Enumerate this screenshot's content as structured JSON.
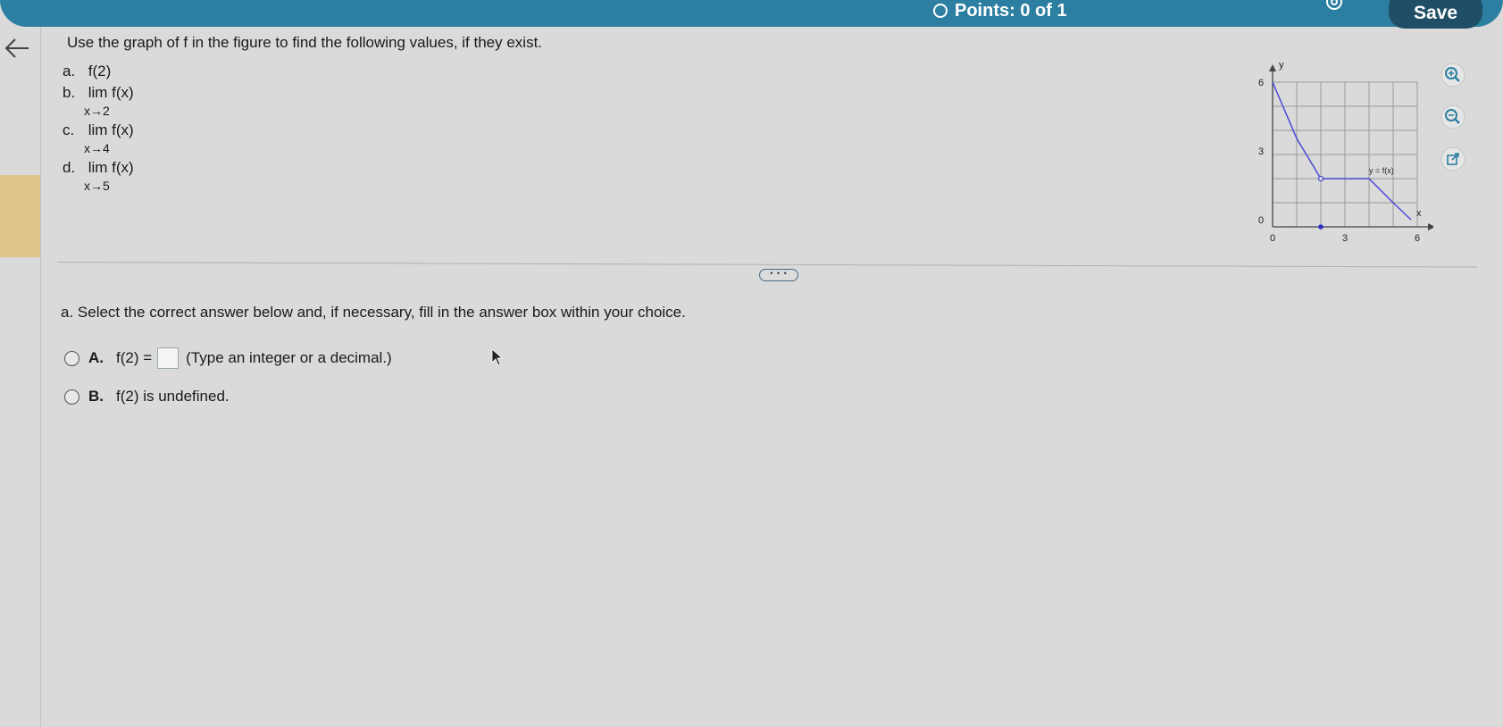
{
  "header": {
    "points_label": "Points: 0 of 1",
    "save_label": "Save"
  },
  "question": {
    "prompt": "Use the graph of f in the figure to find the following values, if they exist.",
    "parts": [
      {
        "label": "a.",
        "expr": "f(2)",
        "sub": ""
      },
      {
        "label": "b.",
        "expr": "lim  f(x)",
        "sub": "x→2"
      },
      {
        "label": "c.",
        "expr": "lim  f(x)",
        "sub": "x→4"
      },
      {
        "label": "d.",
        "expr": "lim  f(x)",
        "sub": "x→5"
      }
    ]
  },
  "graph": {
    "y_axis_label": "y",
    "x_axis_label": "x",
    "y_ticks": [
      "6",
      "3",
      "0"
    ],
    "x_ticks": [
      "0",
      "3",
      "6"
    ],
    "curve_label": "y = f(x)",
    "line_color": "#4a4ad6",
    "grid": true
  },
  "tools": {
    "icons": [
      "zoom-in-icon",
      "zoom-out-icon",
      "external-link-icon"
    ]
  },
  "divider": {
    "more_label": "• • •"
  },
  "answer": {
    "instruction": "a. Select the correct answer below and, if necessary, fill in the answer box within your choice.",
    "choices": [
      {
        "label": "A.",
        "before": "f(2) =",
        "after": "(Type an integer or a decimal.)"
      },
      {
        "label": "B.",
        "text": "f(2) is undefined."
      }
    ]
  }
}
